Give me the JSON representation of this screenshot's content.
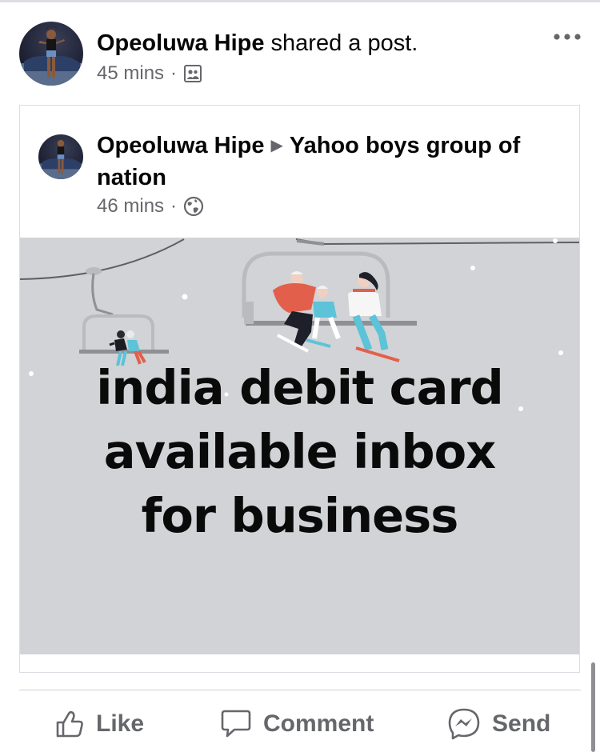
{
  "post": {
    "author": "Opeoluwa Hipe",
    "action": "shared a post.",
    "time": "45 mins",
    "audience_icon": "group-audience-icon",
    "more_icon": "more-dots-icon"
  },
  "shared": {
    "author": "Opeoluwa Hipe",
    "arrow": "▶",
    "group": "Yahoo boys group of nation",
    "time": "46 mins",
    "audience_icon": "globe-icon"
  },
  "image": {
    "lines": [
      "india debit card",
      "available inbox",
      "for business"
    ],
    "background": "#d1d3d6"
  },
  "actions": {
    "like": "Like",
    "comment": "Comment",
    "send": "Send"
  },
  "colors": {
    "text": "#050505",
    "secondary": "#65676b",
    "border": "#dadde1"
  }
}
